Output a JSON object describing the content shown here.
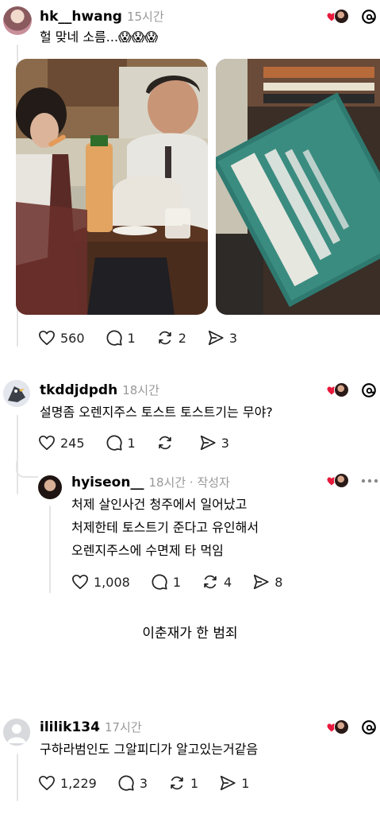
{
  "post1": {
    "username": "hk__hwang",
    "time": "15시간",
    "text": "헐 맞네 소름...😱😱😱",
    "likes": "560",
    "replies": "1",
    "reposts": "2",
    "shares": "3"
  },
  "post2": {
    "username": "tkddjdpdh",
    "time": "18시간",
    "text": "설명좀 오렌지주스 토스트 토스트기는 무야?",
    "likes": "245",
    "replies": "1",
    "reposts": "",
    "shares": "3"
  },
  "post3": {
    "username": "hyiseon__",
    "time": "18시간 · 작성자",
    "lines": [
      "처제 살인사건 청주에서 일어났고",
      "처제한테 토스트기 준다고 유인해서",
      "오렌지주스에 수면제 타 먹임"
    ],
    "likes": "1,008",
    "replies": "1",
    "reposts": "4",
    "shares": "8"
  },
  "caption": "이춘재가 한 범죄",
  "post4": {
    "username": "ililik134",
    "time": "17시간",
    "text": "구하라범인도 그알피디가 알고있는거같음",
    "likes": "1,229",
    "replies": "3",
    "reposts": "1",
    "shares": "1"
  },
  "colors": {
    "heart": "#e8193c",
    "muted": "#999999",
    "line": "#e4e4e4"
  },
  "icons": [
    "heart-icon",
    "comment-icon",
    "repost-icon",
    "share-icon",
    "threads-icon",
    "more-icon"
  ]
}
